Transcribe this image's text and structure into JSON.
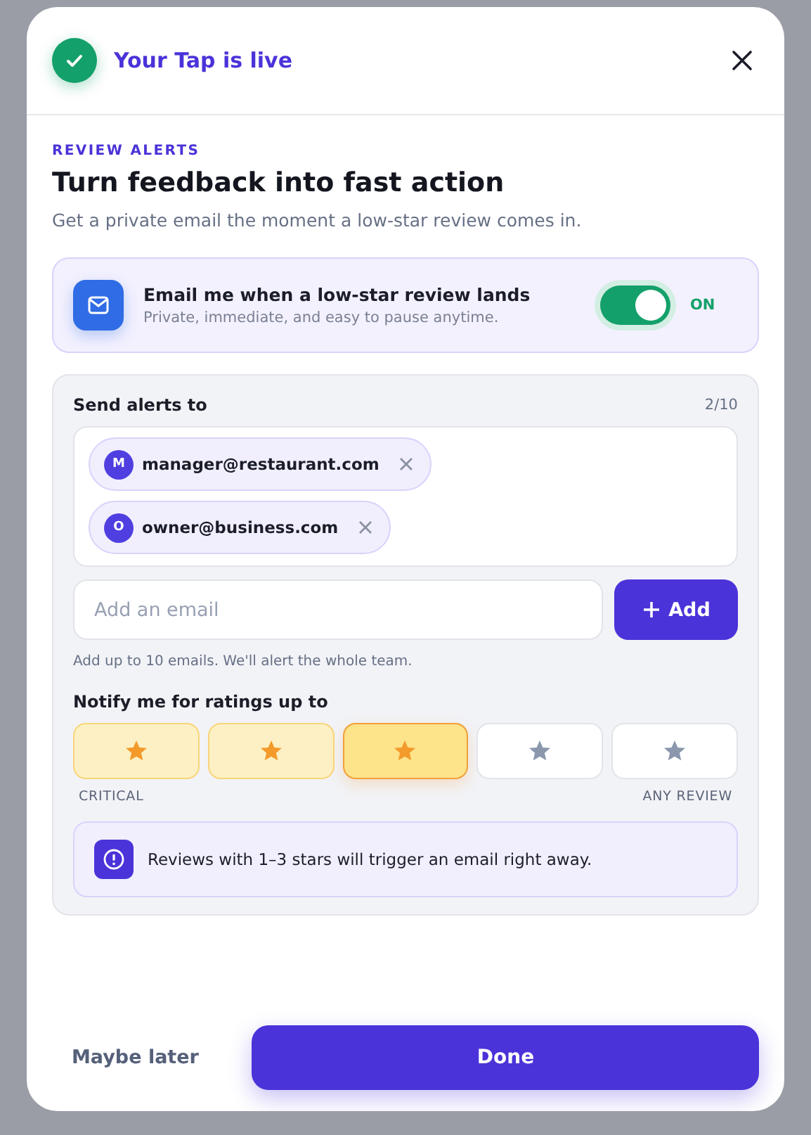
{
  "header": {
    "title": "Your Tap is live"
  },
  "eyebrow": "REVIEW ALERTS",
  "heading": "Turn feedback into fast action",
  "subtitle": "Get a private email the moment a low-star review comes in.",
  "alerts": {
    "title": "Email me when a low-star review lands",
    "subtitle": "Private, immediate, and easy to pause anytime.",
    "on": true,
    "state_label": "ON"
  },
  "recipients": {
    "label": "Send alerts to",
    "count": "2/10",
    "emails": [
      {
        "initial": "M",
        "address": "manager@restaurant.com"
      },
      {
        "initial": "O",
        "address": "owner@business.com"
      }
    ],
    "input": {
      "placeholder": "Add an email"
    },
    "add_button": "Add",
    "hint": "Add up to 10 emails. We'll alert the whole team."
  },
  "rating": {
    "label": "Notify me for ratings up to",
    "options": [
      {
        "selected": false
      },
      {
        "selected": false
      },
      {
        "selected": true
      },
      {
        "selected": false
      },
      {
        "selected": false
      }
    ],
    "low_label": "CRITICAL",
    "high_label": "ANY REVIEW",
    "note": "Reviews with 1–3 stars will trigger an email right away."
  },
  "footer": {
    "secondary": "Maybe later",
    "primary": "Done"
  }
}
